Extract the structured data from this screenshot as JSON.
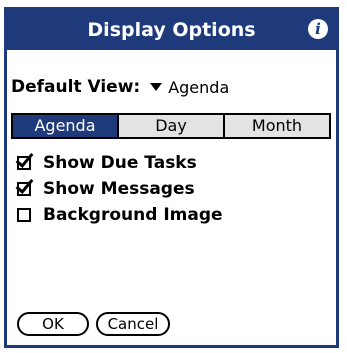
{
  "dialog": {
    "title": "Display Options",
    "info_icon": "i",
    "default_view": {
      "label": "Default View:",
      "value": "Agenda"
    },
    "tabs": [
      {
        "label": "Agenda",
        "active": true
      },
      {
        "label": "Day",
        "active": false
      },
      {
        "label": "Month",
        "active": false
      }
    ],
    "options": [
      {
        "label": "Show Due Tasks",
        "checked": true
      },
      {
        "label": "Show Messages",
        "checked": true
      },
      {
        "label": "Background Image",
        "checked": false
      }
    ],
    "buttons": {
      "ok": "OK",
      "cancel": "Cancel"
    }
  },
  "colors": {
    "title_bar": "#1f3a7a",
    "active_tab": "#1f3a7a",
    "inactive_tab": "#e3e3e3"
  }
}
